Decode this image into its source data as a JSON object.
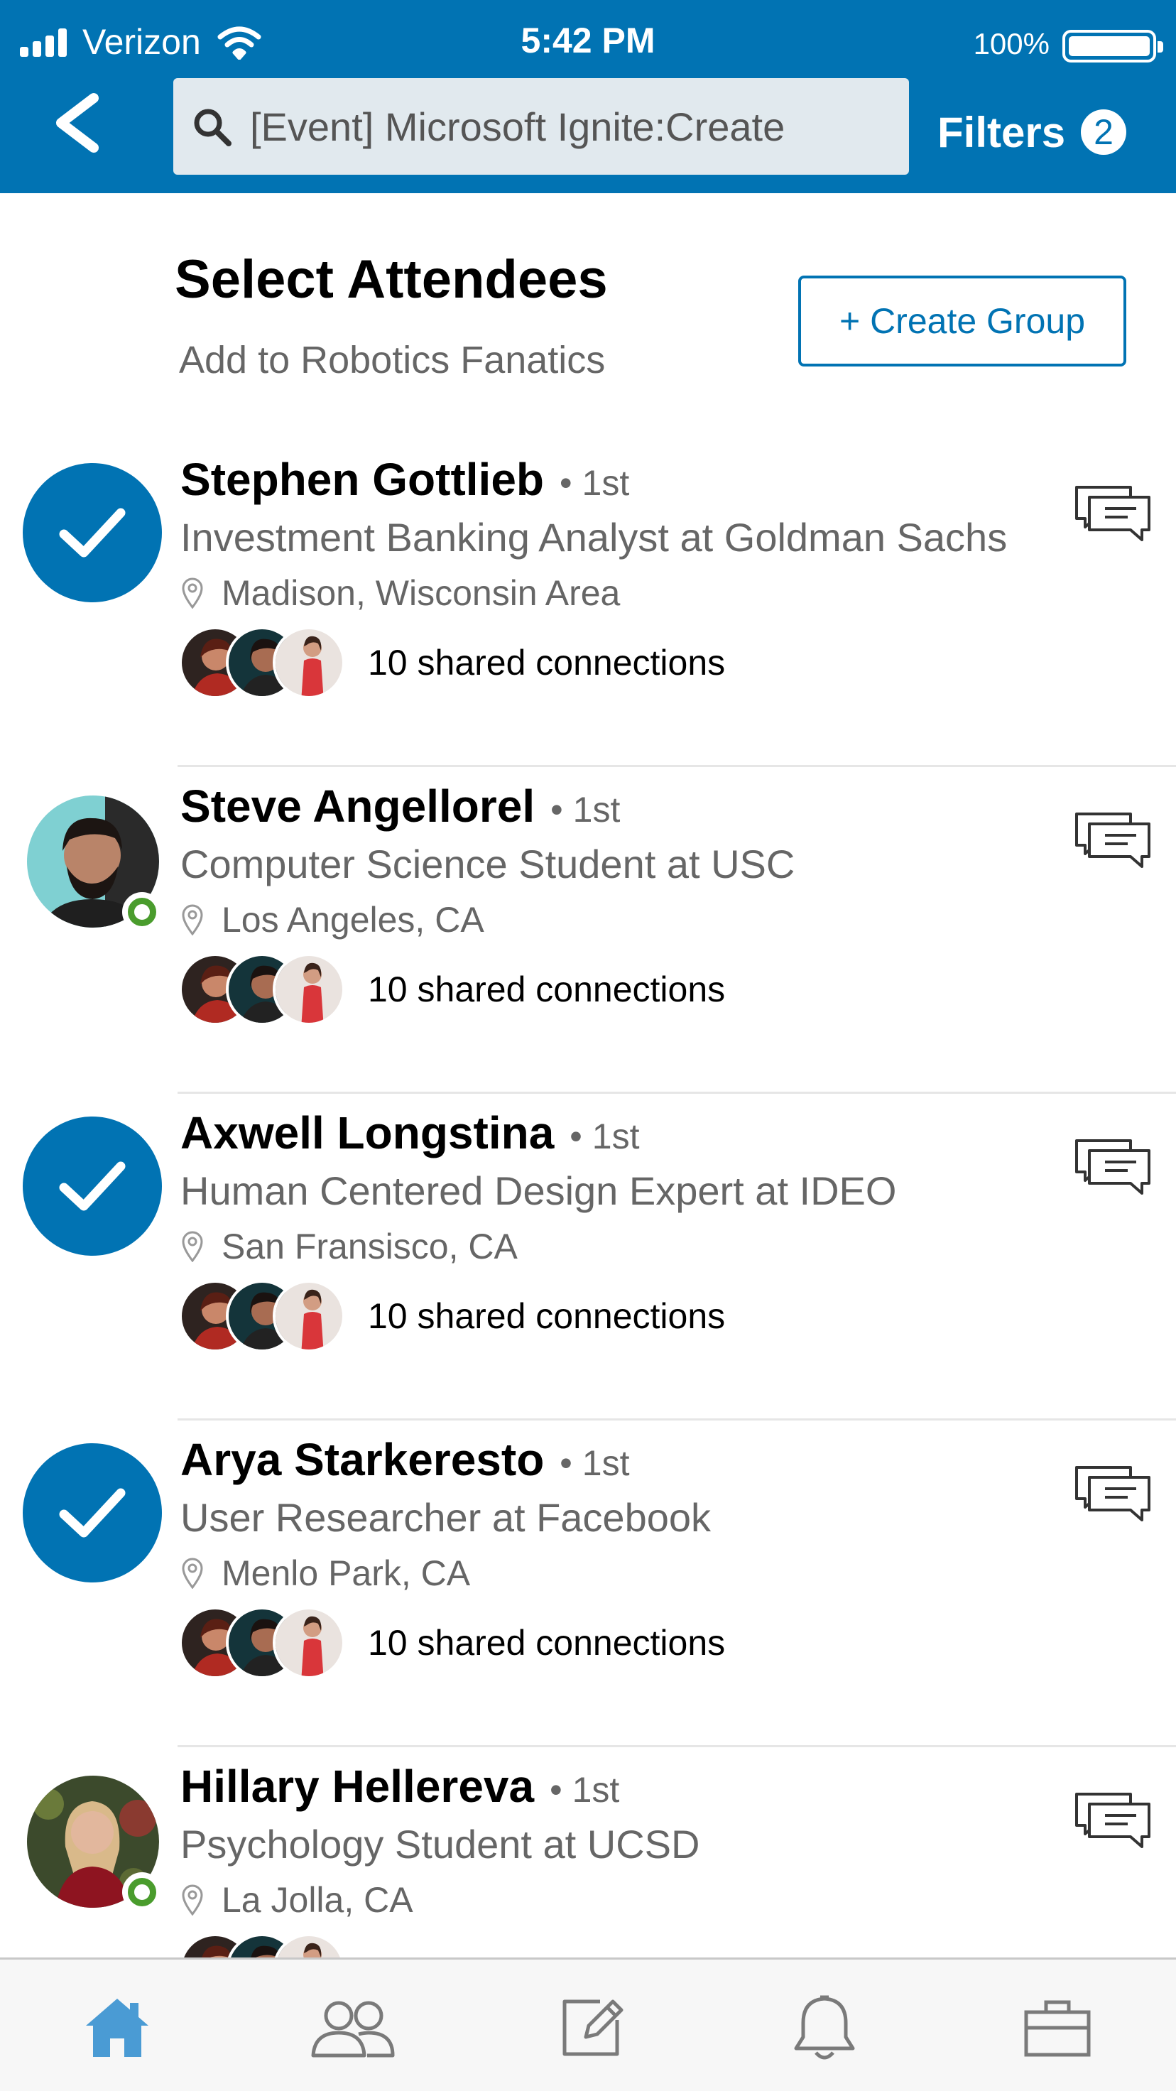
{
  "status_bar": {
    "carrier": "Verizon",
    "time": "5:42 PM",
    "battery": "100%"
  },
  "header": {
    "back_icon": "chevron-left-icon",
    "search_icon": "search-icon",
    "search_value": "[Event] Microsoft Ignite:Create",
    "filters_label": "Filters",
    "filters_count": "2"
  },
  "page": {
    "title": "Select Attendees",
    "subtitle": "Add to Robotics Fanatics",
    "create_group_label": "+ Create Group"
  },
  "attendees": [
    {
      "name": "Stephen Gottlieb",
      "degree": "1st",
      "title": "Investment Banking Analyst at Goldman Sachs",
      "location": "Madison, Wisconsin Area",
      "shared": "10 shared connections",
      "selected": true,
      "online": false
    },
    {
      "name": "Steve Angellorel",
      "degree": "1st",
      "title": "Computer Science Student at USC",
      "location": "Los Angeles, CA",
      "shared": "10 shared connections",
      "selected": false,
      "online": true
    },
    {
      "name": "Axwell Longstina",
      "degree": "1st",
      "title": "Human Centered Design Expert at IDEO",
      "location": "San Fransisco, CA",
      "shared": "10 shared connections",
      "selected": true,
      "online": false
    },
    {
      "name": "Arya Starkeresto",
      "degree": "1st",
      "title": "User Researcher at Facebook",
      "location": "Menlo Park, CA",
      "shared": "10 shared connections",
      "selected": true,
      "online": false
    },
    {
      "name": "Hillary Hellereva",
      "degree": "1st",
      "title": "Psychology Student at UCSD",
      "location": "La Jolla, CA",
      "shared": "",
      "selected": false,
      "online": true
    }
  ],
  "tabbar": {
    "items": [
      "home-icon",
      "my-network-icon",
      "compose-post-icon",
      "notifications-bell-icon",
      "jobs-briefcase-icon"
    ],
    "active": "home-icon"
  },
  "colors": {
    "brand": "#0173b3",
    "online": "#4a9c2d",
    "secondary_text": "#666666",
    "tab_active": "#4a9bd4",
    "tab_inactive": "#7a7a7a"
  }
}
